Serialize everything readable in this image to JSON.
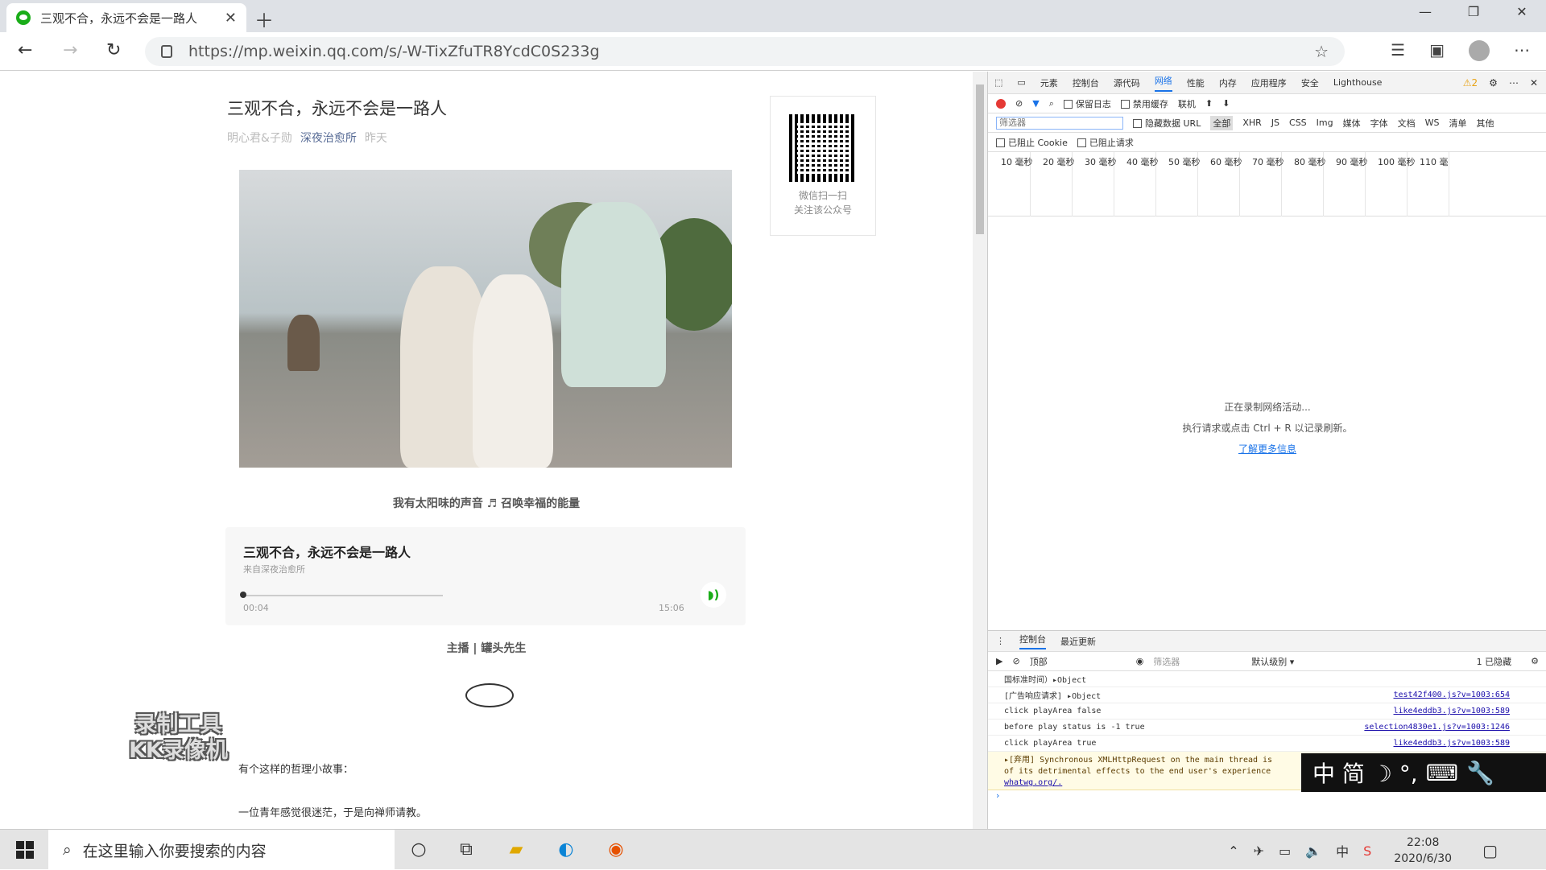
{
  "browser": {
    "tab_title": "三观不合，永远不会是一路人",
    "url": "https://mp.weixin.qq.com/s/-W-TixZfuTR8YcdC0S233g"
  },
  "article": {
    "title": "三观不合，永远不会是一路人",
    "author": "明心君&子勋",
    "account": "深夜治愈所",
    "date": "昨天",
    "qr_caption_1": "微信扫一扫",
    "qr_caption_2": "关注该公众号",
    "photo_caption": "我有太阳味的声音 ♬ 召唤幸福的能量",
    "audio": {
      "title": "三观不合，永远不会是一路人",
      "source": "来自深夜治愈所",
      "current": "00:04",
      "total": "15:06",
      "progress": 0.004
    },
    "host": "主播 | 罐头先生",
    "p1": "有个这样的哲理小故事：",
    "p2": "一位青年感觉很迷茫，于是向禅师请教。"
  },
  "watermark": {
    "line1": "录制工具",
    "line2": "KK录像机"
  },
  "devtools": {
    "tabs": [
      "元素",
      "控制台",
      "源代码",
      "网络",
      "性能",
      "内存",
      "应用程序",
      "安全",
      "Lighthouse"
    ],
    "active_tab": "网络",
    "warning_count": "2",
    "preserve_log": "保留日志",
    "disable_cache": "禁用缓存",
    "throttle": "联机",
    "filter_placeholder": "筛选器",
    "hide_data_url": "隐藏数据 URL",
    "types": [
      "全部",
      "XHR",
      "JS",
      "CSS",
      "Img",
      "媒体",
      "字体",
      "文档",
      "WS",
      "清单",
      "其他"
    ],
    "blocked_cookies": "已阻止 Cookie",
    "blocked_requests": "已阻止请求",
    "timeline": [
      "10 毫秒",
      "20 毫秒",
      "30 毫秒",
      "40 毫秒",
      "50 毫秒",
      "60 毫秒",
      "70 毫秒",
      "80 毫秒",
      "90 毫秒",
      "100 毫秒",
      "110 毫"
    ],
    "empty_1": "正在录制网络活动...",
    "empty_2": "执行请求或点击 Ctrl + R 以记录刷新。",
    "empty_link": "了解更多信息",
    "drawer_tabs": [
      "控制台",
      "最近更新"
    ],
    "context": "顶部",
    "console_filter": "筛选器",
    "level": "默认级别 ▾",
    "hidden": "1 已隐藏",
    "console": [
      {
        "msg": "国标准时间）▸Object",
        "src": ""
      },
      {
        "msg": "[广告响应请求] ▸Object",
        "src": "test42f400.js?v=1003:654"
      },
      {
        "msg": "click playArea false",
        "src": "like4eddb3.js?v=1003:589"
      },
      {
        "msg": "before play status is -1 true",
        "src": "selection4830e1.js?v=1003:1246"
      },
      {
        "msg": "click playArea true",
        "src": "like4eddb3.js?v=1003:589"
      }
    ],
    "warn_line1": "▸[弃用] Synchronous XMLHttpRequest on the main thread is",
    "warn_line2": "of its detrimental effects to the end user's experience",
    "warn_line3": "whatwg.org/."
  },
  "ime": {
    "text": "中 简 ☽ °,"
  },
  "taskbar": {
    "search": "在这里输入你要搜索的内容",
    "time": "22:08",
    "date": "2020/6/30"
  }
}
